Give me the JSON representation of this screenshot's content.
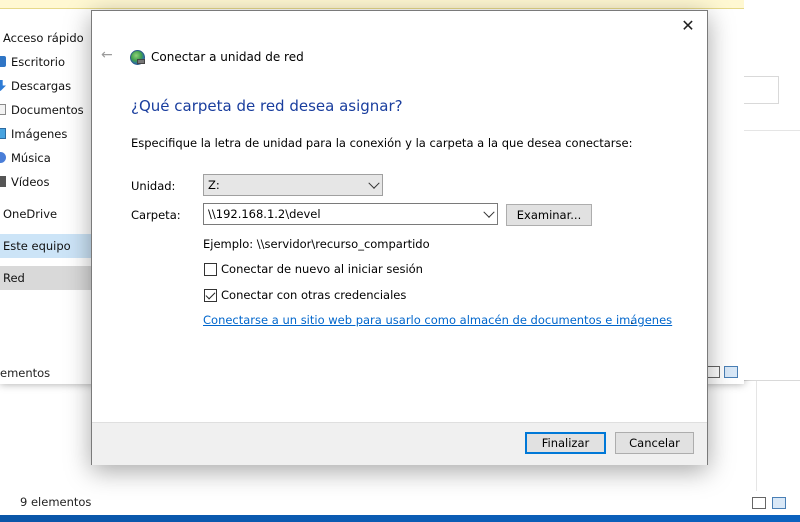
{
  "explorer_back": {
    "status": "9 elementos"
  },
  "explorer_front": {
    "status": "ementos",
    "nav": [
      {
        "label": "Acceso rápido",
        "icon": "star-icon",
        "top": true
      },
      {
        "label": "Escritorio",
        "icon": "pin-icon"
      },
      {
        "label": "Descargas",
        "icon": "download-icon"
      },
      {
        "label": "Documentos",
        "icon": "document-icon"
      },
      {
        "label": "Imágenes",
        "icon": "pictures-icon"
      },
      {
        "label": "Música",
        "icon": "music-icon"
      },
      {
        "label": "Vídeos",
        "icon": "video-icon"
      },
      {
        "label": "OneDrive",
        "icon": "onedrive-icon",
        "top": true
      },
      {
        "label": "Este equipo",
        "icon": "computer-icon",
        "top": true
      },
      {
        "label": "Red",
        "icon": "network-icon",
        "top": true
      }
    ]
  },
  "dialog": {
    "window_title": "Conectar a unidad de red",
    "close_glyph": "✕",
    "back_glyph": "←",
    "heading": "¿Qué carpeta de red desea asignar?",
    "instruction": "Especifique la letra de unidad para la conexión y la carpeta a la que desea conectarse:",
    "drive_label": "Unidad:",
    "drive_value": "Z:",
    "folder_label": "Carpeta:",
    "folder_value": "\\\\192.168.1.2\\devel",
    "browse_label": "Examinar...",
    "example": "Ejemplo: \\\\servidor\\recurso_compartido",
    "reconnect_label": "Conectar de nuevo al iniciar sesión",
    "reconnect_checked": false,
    "credentials_label": "Conectar con otras credenciales",
    "credentials_checked": true,
    "link_text": "Conectarse a un sitio web para usarlo como almacén de documentos e imágenes",
    "link_suffix": ".",
    "finish_label": "Finalizar",
    "cancel_label": "Cancelar"
  },
  "colors": {
    "heading": "#1a3e9e",
    "link": "#0066cc",
    "primary_border": "#0078d7",
    "desktop": "#0d57a6"
  }
}
